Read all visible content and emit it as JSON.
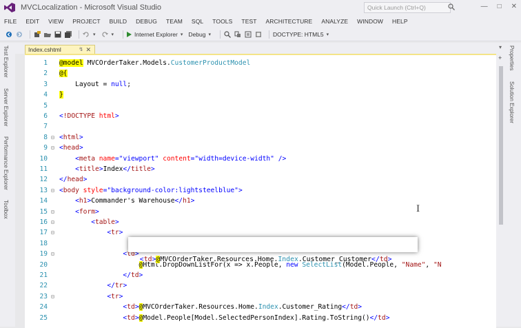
{
  "window": {
    "title": "MVCLocalization - Microsoft Visual Studio",
    "quick_launch_placeholder": "Quick Launch (Ctrl+Q)"
  },
  "menu": [
    "FILE",
    "EDIT",
    "VIEW",
    "PROJECT",
    "BUILD",
    "DEBUG",
    "TEAM",
    "SQL",
    "TOOLS",
    "TEST",
    "ARCHITECTURE",
    "ANALYZE",
    "WINDOW",
    "HELP"
  ],
  "toolbar": {
    "browser": "Internet Explorer",
    "config": "Debug",
    "doctype": "DOCTYPE: HTML5"
  },
  "left_tabs": [
    "Test Explorer",
    "Server Explorer",
    "Performance Explorer",
    "Toolbox"
  ],
  "right_tabs": [
    "Properties",
    "Solution Explorer"
  ],
  "document_tab": {
    "name": "Index.cshtml"
  },
  "callout_text": "<td>@MVCOrderTaker.Resources.Home.Index.Customer_Customer</td>",
  "code_lines": [
    {
      "n": "1",
      "segs": [
        [
          "rz",
          "@model"
        ],
        [
          "t",
          " "
        ],
        [
          "t",
          "MVCOrderTaker.Models."
        ],
        [
          "ty",
          "CustomerProductModel"
        ]
      ]
    },
    {
      "n": "2",
      "segs": [
        [
          "rz",
          "@{"
        ]
      ]
    },
    {
      "n": "3",
      "segs": [
        [
          "t",
          "    Layout = "
        ],
        [
          "kw",
          "null"
        ],
        [
          "t",
          ";"
        ]
      ]
    },
    {
      "n": "4",
      "segs": [
        [
          "rz",
          "}"
        ]
      ]
    },
    {
      "n": "5",
      "segs": []
    },
    {
      "n": "6",
      "segs": [
        [
          "sv",
          "<"
        ],
        [
          "r",
          "!DOCTYPE"
        ],
        [
          "t",
          " "
        ],
        [
          "at",
          "html"
        ],
        [
          "sv",
          ">"
        ]
      ]
    },
    {
      "n": "7",
      "segs": []
    },
    {
      "n": "8",
      "segs": [
        [
          "sv",
          "<"
        ],
        [
          "r",
          "html"
        ],
        [
          "sv",
          ">"
        ]
      ]
    },
    {
      "n": "9",
      "segs": [
        [
          "sv",
          "<"
        ],
        [
          "r",
          "head"
        ],
        [
          "sv",
          ">"
        ]
      ]
    },
    {
      "n": "10",
      "segs": [
        [
          "t",
          "    "
        ],
        [
          "sv",
          "<"
        ],
        [
          "r",
          "meta"
        ],
        [
          "t",
          " "
        ],
        [
          "at",
          "name"
        ],
        [
          "sv",
          "=\"viewport\""
        ],
        [
          "t",
          " "
        ],
        [
          "at",
          "content"
        ],
        [
          "sv",
          "=\"width=device-width\""
        ],
        [
          "t",
          " "
        ],
        [
          "sv",
          "/>"
        ]
      ]
    },
    {
      "n": "11",
      "segs": [
        [
          "t",
          "    "
        ],
        [
          "sv",
          "<"
        ],
        [
          "r",
          "title"
        ],
        [
          "sv",
          ">"
        ],
        [
          "t",
          "Index"
        ],
        [
          "sv",
          "</"
        ],
        [
          "r",
          "title"
        ],
        [
          "sv",
          ">"
        ]
      ]
    },
    {
      "n": "12",
      "segs": [
        [
          "sv",
          "</"
        ],
        [
          "r",
          "head"
        ],
        [
          "sv",
          ">"
        ]
      ]
    },
    {
      "n": "13",
      "segs": [
        [
          "sv",
          "<"
        ],
        [
          "r",
          "body"
        ],
        [
          "t",
          " "
        ],
        [
          "at",
          "style"
        ],
        [
          "sv",
          "=\"background-color:lightsteelblue\""
        ],
        [
          "sv",
          ">"
        ]
      ]
    },
    {
      "n": "14",
      "segs": [
        [
          "t",
          "    "
        ],
        [
          "sv",
          "<"
        ],
        [
          "r",
          "h1"
        ],
        [
          "sv",
          ">"
        ],
        [
          "t",
          "Commander's Warehouse"
        ],
        [
          "sv",
          "</"
        ],
        [
          "r",
          "h1"
        ],
        [
          "sv",
          ">"
        ]
      ]
    },
    {
      "n": "15",
      "segs": [
        [
          "t",
          "    "
        ],
        [
          "sv",
          "<"
        ],
        [
          "r",
          "form"
        ],
        [
          "sv",
          ">"
        ]
      ]
    },
    {
      "n": "16",
      "segs": [
        [
          "t",
          "        "
        ],
        [
          "sv",
          "<"
        ],
        [
          "r",
          "table"
        ],
        [
          "sv",
          ">"
        ]
      ]
    },
    {
      "n": "17",
      "segs": [
        [
          "t",
          "            "
        ],
        [
          "sv",
          "<"
        ],
        [
          "r",
          "tr"
        ],
        [
          "sv",
          ">"
        ]
      ]
    },
    {
      "n": "18",
      "segs": []
    },
    {
      "n": "19",
      "segs": [
        [
          "t",
          "                "
        ],
        [
          "sv",
          "<"
        ],
        [
          "r",
          "td"
        ],
        [
          "sv",
          ">"
        ]
      ]
    },
    {
      "n": "20",
      "segs": [
        [
          "t",
          "                    "
        ],
        [
          "rz",
          "@"
        ],
        [
          "t",
          "Html.DropDownListFor(x => x.People, "
        ],
        [
          "kw",
          "new"
        ],
        [
          "t",
          " "
        ],
        [
          "ty",
          "SelectList"
        ],
        [
          "t",
          "(Model.People, "
        ],
        [
          "r",
          "\"Name\""
        ],
        [
          "t",
          ", "
        ],
        [
          "r",
          "\"N"
        ]
      ]
    },
    {
      "n": "21",
      "segs": [
        [
          "t",
          "                "
        ],
        [
          "sv",
          "</"
        ],
        [
          "r",
          "td"
        ],
        [
          "sv",
          ">"
        ]
      ]
    },
    {
      "n": "22",
      "segs": [
        [
          "t",
          "            "
        ],
        [
          "sv",
          "</"
        ],
        [
          "r",
          "tr"
        ],
        [
          "sv",
          ">"
        ]
      ]
    },
    {
      "n": "23",
      "segs": [
        [
          "t",
          "            "
        ],
        [
          "sv",
          "<"
        ],
        [
          "r",
          "tr"
        ],
        [
          "sv",
          ">"
        ]
      ]
    },
    {
      "n": "24",
      "segs": [
        [
          "t",
          "                "
        ],
        [
          "sv",
          "<"
        ],
        [
          "r",
          "td"
        ],
        [
          "sv",
          ">"
        ],
        [
          "rz",
          "@"
        ],
        [
          "t",
          "MVCOrderTaker.Resources.Home."
        ],
        [
          "ty",
          "Index"
        ],
        [
          "t",
          ".Customer_Rating"
        ],
        [
          "sv",
          "</"
        ],
        [
          "r",
          "td"
        ],
        [
          "sv",
          ">"
        ]
      ]
    },
    {
      "n": "25",
      "segs": [
        [
          "t",
          "                "
        ],
        [
          "sv",
          "<"
        ],
        [
          "r",
          "td"
        ],
        [
          "sv",
          ">"
        ],
        [
          "rz",
          "@"
        ],
        [
          "t",
          "Model.People[Model.SelectedPersonIndex].Rating.ToString()"
        ],
        [
          "sv",
          "</"
        ],
        [
          "r",
          "td"
        ],
        [
          "sv",
          ">"
        ]
      ]
    }
  ],
  "outline_lines": [
    "8",
    "9",
    "13",
    "15",
    "16",
    "17",
    "19",
    "23"
  ]
}
